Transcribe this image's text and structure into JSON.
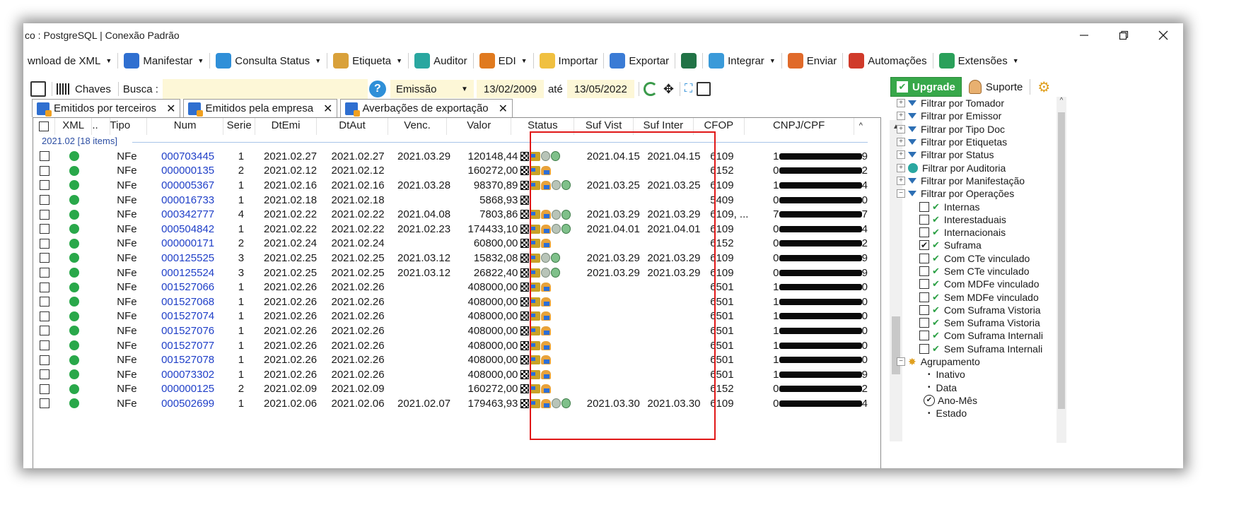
{
  "window": {
    "title": "co : PostgreSQL | Conexão Padrão",
    "minimize": "—",
    "maximize": "☐",
    "close": "✕"
  },
  "menubar": {
    "items": [
      {
        "label": "wnload de XML",
        "caret": true,
        "icon": "download-icon",
        "color": "#3a7bd5"
      },
      {
        "label": "Manifestar",
        "caret": true,
        "icon": "manifest-icon",
        "color": "#2f6fd0"
      },
      {
        "label": "Consulta Status",
        "caret": true,
        "icon": "check-circle-icon",
        "color": "#2f8fd8"
      },
      {
        "label": "Etiqueta",
        "caret": true,
        "icon": "tag-icon",
        "color": "#d9a13a"
      },
      {
        "label": "Auditor",
        "caret": false,
        "icon": "auditor-icon",
        "color": "#2aa7a0"
      },
      {
        "label": "EDI",
        "caret": true,
        "icon": "truck-icon",
        "color": "#e07a1f"
      },
      {
        "label": "Importar",
        "caret": false,
        "icon": "folder-icon",
        "color": "#f0c040"
      },
      {
        "label": "Exportar",
        "caret": false,
        "icon": "save-icon",
        "color": "#3a7bd5"
      },
      {
        "label": "",
        "caret": false,
        "icon": "excel-icon",
        "color": "#217346"
      },
      {
        "label": "Integrar",
        "caret": true,
        "icon": "gears-icon",
        "color": "#3a9ad9"
      },
      {
        "label": "Enviar",
        "caret": false,
        "icon": "envelope-icon",
        "color": "#e06a2a"
      },
      {
        "label": "Automações",
        "caret": false,
        "icon": "automation-icon",
        "color": "#d03a2a"
      },
      {
        "label": "Extensões",
        "caret": true,
        "icon": "extensions-icon",
        "color": "#2aa05a"
      }
    ]
  },
  "filterbar": {
    "chaves_label": "Chaves",
    "busca_label": "Busca :",
    "busca_value": "",
    "date_type": "Emissão",
    "date_from": "13/02/2009",
    "ate_label": "até",
    "date_to": "13/05/2022"
  },
  "tabs": [
    {
      "label": "Emitidos por terceiros",
      "close": "✕"
    },
    {
      "label": "Emitidos pela empresa",
      "close": "✕"
    },
    {
      "label": "Averbações de exportação",
      "close": "✕"
    }
  ],
  "grid": {
    "columns": [
      "XML",
      "..",
      "Tipo",
      "Num",
      "Serie",
      "DtEmi",
      "DtAut",
      "Venc.",
      "Valor",
      "Status",
      "Suf Vist",
      "Suf Inter",
      "CFOP",
      "CNPJ/CPF"
    ],
    "group_label": "2021.02 [18 items]",
    "rows": [
      {
        "tipo": "NFe",
        "num": "000703445",
        "serie": "1",
        "dtemi": "2021.02.27",
        "dtaut": "2021.02.27",
        "venc": "2021.03.29",
        "valor": "120148,44",
        "status": [
          "flag",
          "truck",
          "shield",
          "pin"
        ],
        "suf_vist": "2021.04.15",
        "suf_inter": "2021.04.15",
        "cfop": "6109",
        "cnpj_first": "1",
        "cnpj_last": "9"
      },
      {
        "tipo": "NFe",
        "num": "000000135",
        "serie": "2",
        "dtemi": "2021.02.12",
        "dtaut": "2021.02.12",
        "venc": "",
        "valor": "160272,00",
        "status": [
          "flag",
          "truck",
          "person"
        ],
        "suf_vist": "",
        "suf_inter": "",
        "cfop": "6152",
        "cnpj_first": "0",
        "cnpj_last": "2"
      },
      {
        "tipo": "NFe",
        "num": "000005367",
        "serie": "1",
        "dtemi": "2021.02.16",
        "dtaut": "2021.02.16",
        "venc": "2021.03.28",
        "valor": "98370,89",
        "status": [
          "flag",
          "truck",
          "person",
          "shield",
          "pin"
        ],
        "suf_vist": "2021.03.25",
        "suf_inter": "2021.03.25",
        "cfop": "6109",
        "cnpj_first": "1",
        "cnpj_last": "4"
      },
      {
        "tipo": "NFe",
        "num": "000016733",
        "serie": "1",
        "dtemi": "2021.02.18",
        "dtaut": "2021.02.18",
        "venc": "",
        "valor": "5868,93",
        "status": [
          "flag"
        ],
        "suf_vist": "",
        "suf_inter": "",
        "cfop": "5409",
        "cnpj_first": "0",
        "cnpj_last": "0"
      },
      {
        "tipo": "NFe",
        "num": "000342777",
        "serie": "4",
        "dtemi": "2021.02.22",
        "dtaut": "2021.02.22",
        "venc": "2021.04.08",
        "valor": "7803,86",
        "status": [
          "flag",
          "truck",
          "person",
          "shield",
          "pin"
        ],
        "suf_vist": "2021.03.29",
        "suf_inter": "2021.03.29",
        "cfop": "6109, ...",
        "cnpj_first": "7",
        "cnpj_last": "7"
      },
      {
        "tipo": "NFe",
        "num": "000504842",
        "serie": "1",
        "dtemi": "2021.02.22",
        "dtaut": "2021.02.22",
        "venc": "2021.02.23",
        "valor": "174433,10",
        "status": [
          "flag",
          "truck",
          "person",
          "shield",
          "pin"
        ],
        "suf_vist": "2021.04.01",
        "suf_inter": "2021.04.01",
        "cfop": "6109",
        "cnpj_first": "0",
        "cnpj_last": "4"
      },
      {
        "tipo": "NFe",
        "num": "000000171",
        "serie": "2",
        "dtemi": "2021.02.24",
        "dtaut": "2021.02.24",
        "venc": "",
        "valor": "60800,00",
        "status": [
          "flag",
          "truck",
          "person"
        ],
        "suf_vist": "",
        "suf_inter": "",
        "cfop": "6152",
        "cnpj_first": "0",
        "cnpj_last": "2"
      },
      {
        "tipo": "NFe",
        "num": "000125525",
        "serie": "3",
        "dtemi": "2021.02.25",
        "dtaut": "2021.02.25",
        "venc": "2021.03.12",
        "valor": "15832,08",
        "status": [
          "flag",
          "truck",
          "shield",
          "pin"
        ],
        "suf_vist": "2021.03.29",
        "suf_inter": "2021.03.29",
        "cfop": "6109",
        "cnpj_first": "0",
        "cnpj_last": "9"
      },
      {
        "tipo": "NFe",
        "num": "000125524",
        "serie": "3",
        "dtemi": "2021.02.25",
        "dtaut": "2021.02.25",
        "venc": "2021.03.12",
        "valor": "26822,40",
        "status": [
          "flag",
          "truck",
          "shield",
          "pin"
        ],
        "suf_vist": "2021.03.29",
        "suf_inter": "2021.03.29",
        "cfop": "6109",
        "cnpj_first": "0",
        "cnpj_last": "9"
      },
      {
        "tipo": "NFe",
        "num": "001527066",
        "serie": "1",
        "dtemi": "2021.02.26",
        "dtaut": "2021.02.26",
        "venc": "",
        "valor": "408000,00",
        "status": [
          "flag",
          "truck",
          "person"
        ],
        "suf_vist": "",
        "suf_inter": "",
        "cfop": "6501",
        "cnpj_first": "1",
        "cnpj_last": "0"
      },
      {
        "tipo": "NFe",
        "num": "001527068",
        "serie": "1",
        "dtemi": "2021.02.26",
        "dtaut": "2021.02.26",
        "venc": "",
        "valor": "408000,00",
        "status": [
          "flag",
          "truck",
          "person"
        ],
        "suf_vist": "",
        "suf_inter": "",
        "cfop": "6501",
        "cnpj_first": "1",
        "cnpj_last": "0"
      },
      {
        "tipo": "NFe",
        "num": "001527074",
        "serie": "1",
        "dtemi": "2021.02.26",
        "dtaut": "2021.02.26",
        "venc": "",
        "valor": "408000,00",
        "status": [
          "flag",
          "truck",
          "person"
        ],
        "suf_vist": "",
        "suf_inter": "",
        "cfop": "6501",
        "cnpj_first": "1",
        "cnpj_last": "0"
      },
      {
        "tipo": "NFe",
        "num": "001527076",
        "serie": "1",
        "dtemi": "2021.02.26",
        "dtaut": "2021.02.26",
        "venc": "",
        "valor": "408000,00",
        "status": [
          "flag",
          "truck",
          "person"
        ],
        "suf_vist": "",
        "suf_inter": "",
        "cfop": "6501",
        "cnpj_first": "1",
        "cnpj_last": "0"
      },
      {
        "tipo": "NFe",
        "num": "001527077",
        "serie": "1",
        "dtemi": "2021.02.26",
        "dtaut": "2021.02.26",
        "venc": "",
        "valor": "408000,00",
        "status": [
          "flag",
          "truck",
          "person"
        ],
        "suf_vist": "",
        "suf_inter": "",
        "cfop": "6501",
        "cnpj_first": "1",
        "cnpj_last": "0"
      },
      {
        "tipo": "NFe",
        "num": "001527078",
        "serie": "1",
        "dtemi": "2021.02.26",
        "dtaut": "2021.02.26",
        "venc": "",
        "valor": "408000,00",
        "status": [
          "flag",
          "truck",
          "person"
        ],
        "suf_vist": "",
        "suf_inter": "",
        "cfop": "6501",
        "cnpj_first": "1",
        "cnpj_last": "0"
      },
      {
        "tipo": "NFe",
        "num": "000073302",
        "serie": "1",
        "dtemi": "2021.02.26",
        "dtaut": "2021.02.26",
        "venc": "",
        "valor": "408000,00",
        "status": [
          "flag",
          "truck",
          "person"
        ],
        "suf_vist": "",
        "suf_inter": "",
        "cfop": "6501",
        "cnpj_first": "1",
        "cnpj_last": "9"
      },
      {
        "tipo": "NFe",
        "num": "000000125",
        "serie": "2",
        "dtemi": "2021.02.09",
        "dtaut": "2021.02.09",
        "venc": "",
        "valor": "160272,00",
        "status": [
          "flag",
          "truck",
          "person"
        ],
        "suf_vist": "",
        "suf_inter": "",
        "cfop": "6152",
        "cnpj_first": "0",
        "cnpj_last": "2"
      },
      {
        "tipo": "NFe",
        "num": "000502699",
        "serie": "1",
        "dtemi": "2021.02.06",
        "dtaut": "2021.02.06",
        "venc": "2021.02.07",
        "valor": "179463,93",
        "status": [
          "flag",
          "truck",
          "person",
          "shield",
          "pin"
        ],
        "suf_vist": "2021.03.30",
        "suf_inter": "2021.03.30",
        "cfop": "6109",
        "cnpj_first": "0",
        "cnpj_last": "4"
      }
    ]
  },
  "right_panel": {
    "upgrade_label": "Upgrade",
    "suporte_label": "Suporte",
    "tree": [
      {
        "kind": "filter",
        "label": "Filtrar por Tomador"
      },
      {
        "kind": "filter",
        "label": "Filtrar por Emissor"
      },
      {
        "kind": "filter",
        "label": "Filtrar por Tipo Doc"
      },
      {
        "kind": "filter",
        "label": "Filtrar por Etiquetas"
      },
      {
        "kind": "filter",
        "label": "Filtrar por Status"
      },
      {
        "kind": "auditor",
        "label": "Filtrar por Auditoria"
      },
      {
        "kind": "filter",
        "label": "Filtrar por Manifestação"
      },
      {
        "kind": "filter-open",
        "label": "Filtrar por Operações"
      },
      {
        "kind": "option",
        "label": "Internas",
        "checked": false
      },
      {
        "kind": "option",
        "label": "Interestaduais",
        "checked": false
      },
      {
        "kind": "option",
        "label": "Internacionais",
        "checked": false
      },
      {
        "kind": "option",
        "label": "Suframa",
        "checked": true
      },
      {
        "kind": "option",
        "label": "Com CTe vinculado",
        "checked": false
      },
      {
        "kind": "option",
        "label": "Sem CTe vinculado",
        "checked": false
      },
      {
        "kind": "option",
        "label": "Com MDFe vinculado",
        "checked": false
      },
      {
        "kind": "option",
        "label": "Sem MDFe vinculado",
        "checked": false
      },
      {
        "kind": "option",
        "label": "Com Suframa Vistoria",
        "checked": false
      },
      {
        "kind": "option",
        "label": "Sem Suframa Vistoria",
        "checked": false
      },
      {
        "kind": "option",
        "label": "Com Suframa Internali",
        "checked": false
      },
      {
        "kind": "option",
        "label": "Sem Suframa Internali",
        "checked": false
      },
      {
        "kind": "group",
        "label": "Agrupamento"
      },
      {
        "kind": "radio",
        "label": "Inativo",
        "selected": false
      },
      {
        "kind": "radio",
        "label": "Data",
        "selected": false
      },
      {
        "kind": "radio",
        "label": "Ano-Mês",
        "selected": true
      },
      {
        "kind": "radio",
        "label": "Estado",
        "selected": false
      }
    ]
  },
  "colors": {
    "accent_link": "#1f3fc8",
    "highlight_box": "#e01818",
    "upgrade_green": "#37a84a",
    "input_yellow": "#fdf7d7"
  }
}
